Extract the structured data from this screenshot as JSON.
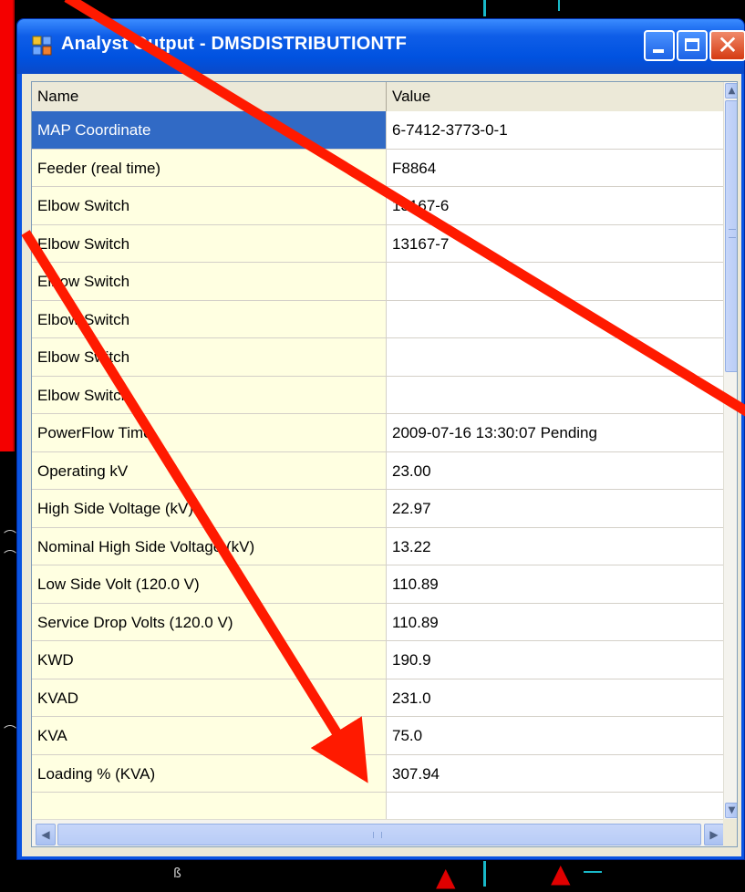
{
  "window": {
    "title": "Analyst Output - DMSDISTRIBUTIONTF",
    "icon": "app-window-icon",
    "controls": [
      "minimize-icon",
      "maximize-icon",
      "close-icon"
    ]
  },
  "grid": {
    "columns": {
      "name": "Name",
      "value": "Value"
    },
    "rows": [
      {
        "name": "MAP Coordinate",
        "value": "6-7412-3773-0-1",
        "selected": true
      },
      {
        "name": "Feeder (real time)",
        "value": "F8864"
      },
      {
        "name": "Elbow Switch",
        "value": "13167-6"
      },
      {
        "name": "Elbow Switch",
        "value": "13167-7"
      },
      {
        "name": "Elbow Switch",
        "value": ""
      },
      {
        "name": "Elbow Switch",
        "value": ""
      },
      {
        "name": "Elbow Switch",
        "value": ""
      },
      {
        "name": "Elbow Switch",
        "value": ""
      },
      {
        "name": "PowerFlow Time",
        "value": "2009-07-16 13:30:07 Pending"
      },
      {
        "name": "Operating kV",
        "value": "23.00"
      },
      {
        "name": "High Side Voltage (kV)",
        "value": "22.97"
      },
      {
        "name": "Nominal High Side Voltage (kV)",
        "value": "13.22"
      },
      {
        "name": "Low Side Volt (120.0 V)",
        "value": "110.89"
      },
      {
        "name": "Service Drop Volts (120.0 V)",
        "value": "110.89"
      },
      {
        "name": "KWD",
        "value": "190.9"
      },
      {
        "name": "KVAD",
        "value": "231.0"
      },
      {
        "name": "KVA",
        "value": "75.0"
      },
      {
        "name": "Loading % (KVA)",
        "value": "307.94"
      },
      {
        "name": "",
        "value": ""
      }
    ]
  },
  "colors": {
    "selection": "#316ac5",
    "name_column_bg": "#ffffe1",
    "annotation_arrow": "#ff1a00",
    "titlebar": "#0a54e2"
  },
  "icons": {
    "scroll_up": "scroll-up-arrow-icon",
    "scroll_down": "scroll-down-arrow-icon",
    "scroll_left": "scroll-left-arrow-icon",
    "scroll_right": "scroll-right-arrow-icon"
  }
}
